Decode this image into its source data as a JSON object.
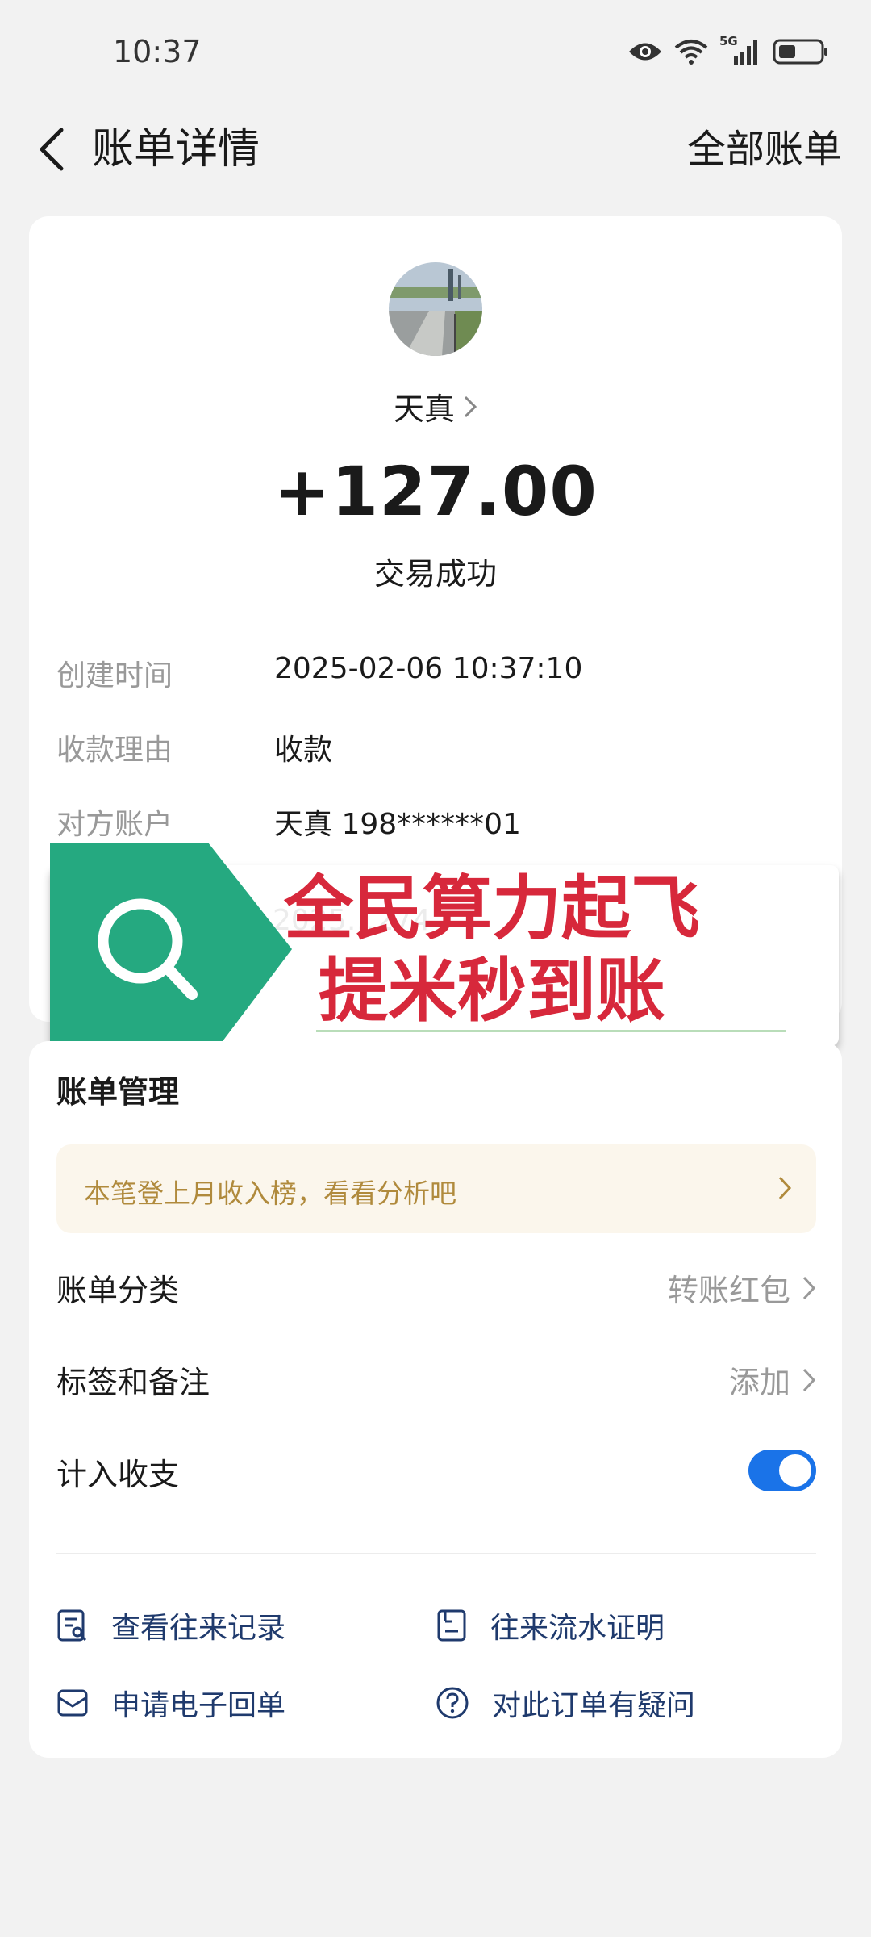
{
  "status_bar": {
    "time": "10:37",
    "network": "5G"
  },
  "header": {
    "title": "账单详情",
    "right_action": "全部账单"
  },
  "transaction": {
    "payee": "天真",
    "amount": "+127.00",
    "status": "交易成功",
    "details": [
      {
        "label": "创建时间",
        "value": "2025-02-06 10:37:10"
      },
      {
        "label": "收款理由",
        "value": "收款"
      },
      {
        "label": "对方账户",
        "value": "天真 198******01"
      }
    ],
    "obscured_value": "2025…274"
  },
  "ad_banner": {
    "line1": "全民算力起飞",
    "line2": "提米秒到账"
  },
  "management": {
    "title": "账单管理",
    "tip": "本笔登上月收入榜，看看分析吧",
    "rows": [
      {
        "label": "账单分类",
        "value": "转账红包"
      },
      {
        "label": "标签和备注",
        "value": "添加"
      },
      {
        "label": "计入收支",
        "toggle_on": true
      }
    ],
    "actions": [
      {
        "label": "查看往来记录",
        "icon": "record-search-icon"
      },
      {
        "label": "往来流水证明",
        "icon": "document-icon"
      },
      {
        "label": "申请电子回单",
        "icon": "mail-icon"
      },
      {
        "label": "对此订单有疑问",
        "icon": "question-icon"
      }
    ]
  },
  "colors": {
    "accent": "#1a73e8",
    "ad_red": "#d7283b",
    "ad_green": "#25a980",
    "tip_text": "#b08a3c"
  }
}
